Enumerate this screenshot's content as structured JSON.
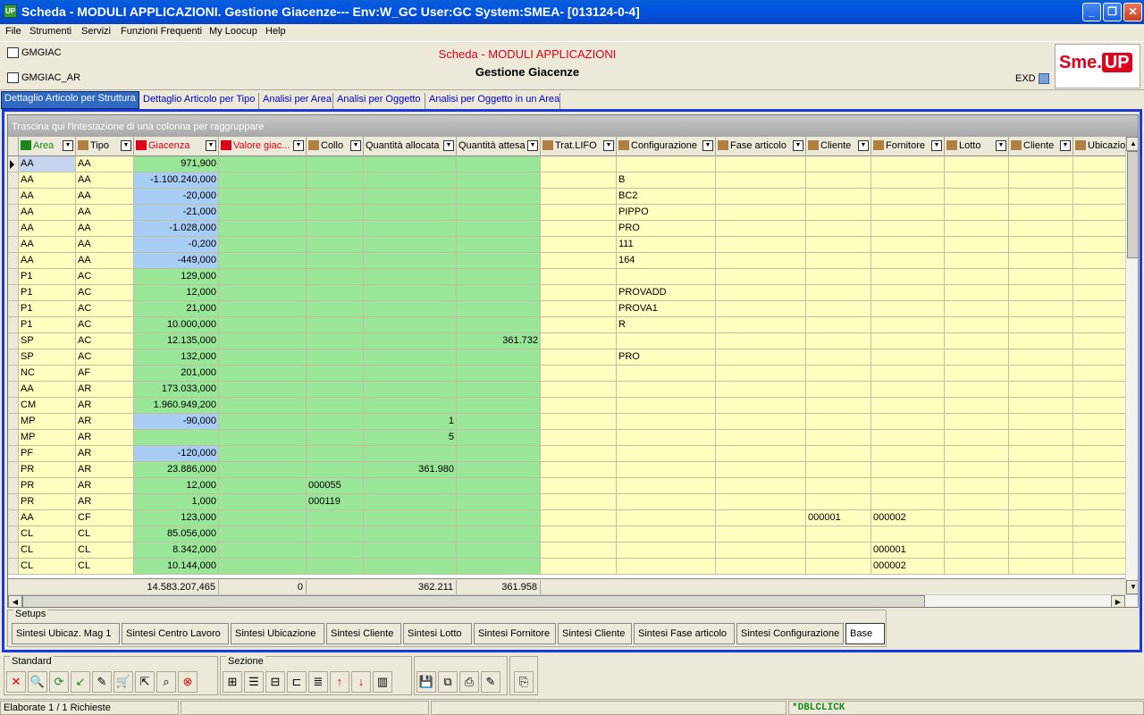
{
  "window": {
    "title": "Scheda - MODULI APPLICAZIONI. Gestione Giacenze--- Env:W_GC User:GC System:SMEA- [013124-0-4]",
    "app_icon_text": "UP",
    "minimize": "_",
    "maximize": "❐",
    "close": "✕"
  },
  "menu": [
    "File",
    "Strumenti",
    "Servizi",
    "Funzioni Frequenti",
    "My Loocup",
    "Help"
  ],
  "header": {
    "left_item1": "GMGIAC",
    "left_item2": "GMGIAC_AR",
    "title": "Scheda - MODULI APPLICAZIONI",
    "subtitle": "Gestione Giacenze",
    "exd": "EXD",
    "logo_text": "Sme.",
    "logo_up": "UP"
  },
  "tabs": [
    "Dettaglio Articolo per Struttura",
    "Dettaglio Articolo per Tipo",
    "Analisi per Area",
    "Analisi per Oggetto",
    "Analisi per Oggetto in un Area"
  ],
  "grid": {
    "group_hint": "Trascina qui l'intestazione di una colonna per raggruppare",
    "columns": [
      {
        "label": "Area",
        "icon": "area-icon",
        "color": "#1a8a1a"
      },
      {
        "label": "Tipo",
        "icon": "list-icon",
        "color": "#000000"
      },
      {
        "label": "Giacenza",
        "icon": "chart-icon",
        "color": "#e0001a"
      },
      {
        "label": "Valore giac...",
        "icon": "chart-icon",
        "color": "#e0001a"
      },
      {
        "label": "Collo",
        "icon": "box-icon",
        "color": "#000000"
      },
      {
        "label": "Quantità allocata",
        "icon": "",
        "color": "#000000"
      },
      {
        "label": "Quantità attesa",
        "icon": "",
        "color": "#000000"
      },
      {
        "label": "Trat.LIFO",
        "icon": "lifo-icon",
        "color": "#000000"
      },
      {
        "label": "Configurazione",
        "icon": "config-icon",
        "color": "#000000"
      },
      {
        "label": "Fase articolo",
        "icon": "phase-icon",
        "color": "#000000"
      },
      {
        "label": "Cliente",
        "icon": "user-icon",
        "color": "#000000"
      },
      {
        "label": "Fornitore",
        "icon": "user-icon",
        "color": "#000000"
      },
      {
        "label": "Lotto",
        "icon": "lot-icon",
        "color": "#000000"
      },
      {
        "label": "Cliente",
        "icon": "user-icon",
        "color": "#000000"
      },
      {
        "label": "Ubicazio",
        "icon": "location-icon",
        "color": "#000000"
      }
    ],
    "rows": [
      [
        "AA",
        "AA",
        "971,900",
        "",
        "",
        "",
        "",
        "",
        "",
        "",
        "",
        "",
        "",
        "",
        ""
      ],
      [
        "AA",
        "AA",
        "-1.100.240,000",
        "",
        "",
        "",
        "",
        "",
        "B",
        "",
        "",
        "",
        "",
        "",
        ""
      ],
      [
        "AA",
        "AA",
        "-20,000",
        "",
        "",
        "",
        "",
        "",
        "BC2",
        "",
        "",
        "",
        "",
        "",
        ""
      ],
      [
        "AA",
        "AA",
        "-21,000",
        "",
        "",
        "",
        "",
        "",
        "PIPPO",
        "",
        "",
        "",
        "",
        "",
        ""
      ],
      [
        "AA",
        "AA",
        "-1.028,000",
        "",
        "",
        "",
        "",
        "",
        "PRO",
        "",
        "",
        "",
        "",
        "",
        ""
      ],
      [
        "AA",
        "AA",
        "-0,200",
        "",
        "",
        "",
        "",
        "",
        "111",
        "",
        "",
        "",
        "",
        "",
        ""
      ],
      [
        "AA",
        "AA",
        "-449,000",
        "",
        "",
        "",
        "",
        "",
        "164",
        "",
        "",
        "",
        "",
        "",
        ""
      ],
      [
        "P1",
        "AC",
        "129,000",
        "",
        "",
        "",
        "",
        "",
        "",
        "",
        "",
        "",
        "",
        "",
        ""
      ],
      [
        "P1",
        "AC",
        "12,000",
        "",
        "",
        "",
        "",
        "",
        "PROVADD",
        "",
        "",
        "",
        "",
        "",
        ""
      ],
      [
        "P1",
        "AC",
        "21,000",
        "",
        "",
        "",
        "",
        "",
        "PROVA1",
        "",
        "",
        "",
        "",
        "",
        ""
      ],
      [
        "P1",
        "AC",
        "10.000,000",
        "",
        "",
        "",
        "",
        "",
        "R",
        "",
        "",
        "",
        "",
        "",
        ""
      ],
      [
        "SP",
        "AC",
        "12.135,000",
        "",
        "",
        "",
        "361.732",
        "",
        "",
        "",
        "",
        "",
        "",
        "",
        ""
      ],
      [
        "SP",
        "AC",
        "132,000",
        "",
        "",
        "",
        "",
        "",
        "PRO",
        "",
        "",
        "",
        "",
        "",
        ""
      ],
      [
        "NC",
        "AF",
        "201,000",
        "",
        "",
        "",
        "",
        "",
        "",
        "",
        "",
        "",
        "",
        "",
        ""
      ],
      [
        "AA",
        "AR",
        "173.033,000",
        "",
        "",
        "",
        "",
        "",
        "",
        "",
        "",
        "",
        "",
        "",
        ""
      ],
      [
        "CM",
        "AR",
        "1.960.949,200",
        "",
        "",
        "",
        "",
        "",
        "",
        "",
        "",
        "",
        "",
        "",
        ""
      ],
      [
        "MP",
        "AR",
        "-90,000",
        "",
        "",
        "1",
        "",
        "",
        "",
        "",
        "",
        "",
        "",
        "",
        ""
      ],
      [
        "MP",
        "AR",
        "",
        "",
        "",
        "5",
        "",
        "",
        "",
        "",
        "",
        "",
        "",
        "",
        ""
      ],
      [
        "PF",
        "AR",
        "-120,000",
        "",
        "",
        "",
        "",
        "",
        "",
        "",
        "",
        "",
        "",
        "",
        ""
      ],
      [
        "PR",
        "AR",
        "23.886,000",
        "",
        "",
        "361.980",
        "",
        "",
        "",
        "",
        "",
        "",
        "",
        "",
        ""
      ],
      [
        "PR",
        "AR",
        "12,000",
        "",
        "000055",
        "",
        "",
        "",
        "",
        "",
        "",
        "",
        "",
        "",
        ""
      ],
      [
        "PR",
        "AR",
        "1,000",
        "",
        "000119",
        "",
        "",
        "",
        "",
        "",
        "",
        "",
        "",
        "",
        ""
      ],
      [
        "AA",
        "CF",
        "123,000",
        "",
        "",
        "",
        "",
        "",
        "",
        "",
        "000001",
        "000002",
        "",
        "",
        ""
      ],
      [
        "CL",
        "CL",
        "85.056,000",
        "",
        "",
        "",
        "",
        "",
        "",
        "",
        "",
        "",
        "",
        "",
        ""
      ],
      [
        "CL",
        "CL",
        "8.342,000",
        "",
        "",
        "",
        "",
        "",
        "",
        "",
        "",
        "000001",
        "",
        "",
        ""
      ],
      [
        "CL",
        "CL",
        "10.144,000",
        "",
        "",
        "",
        "",
        "",
        "",
        "",
        "",
        "000002",
        "",
        "",
        ""
      ]
    ],
    "totals": {
      "giacenza": "14.583.207,465",
      "valore": "0",
      "allocata": "362.211",
      "attesa": "361.958"
    }
  },
  "setups": {
    "label": "Setups",
    "buttons": [
      "Sintesi Ubicaz. Mag 1",
      "Sintesi Centro Lavoro",
      "Sintesi Ubicazione",
      "Sintesi Cliente",
      "Sintesi Lotto",
      "Sintesi Fornitore",
      "Sintesi Cliente",
      "Sintesi Fase articolo",
      "Sintesi Configurazione",
      "Base"
    ]
  },
  "toolbar": {
    "standard_label": "Standard",
    "sezione_label": "Sezione"
  },
  "status": {
    "left": "Elaborate 1 / 1 Richieste",
    "right": "*DBLCLICK"
  }
}
